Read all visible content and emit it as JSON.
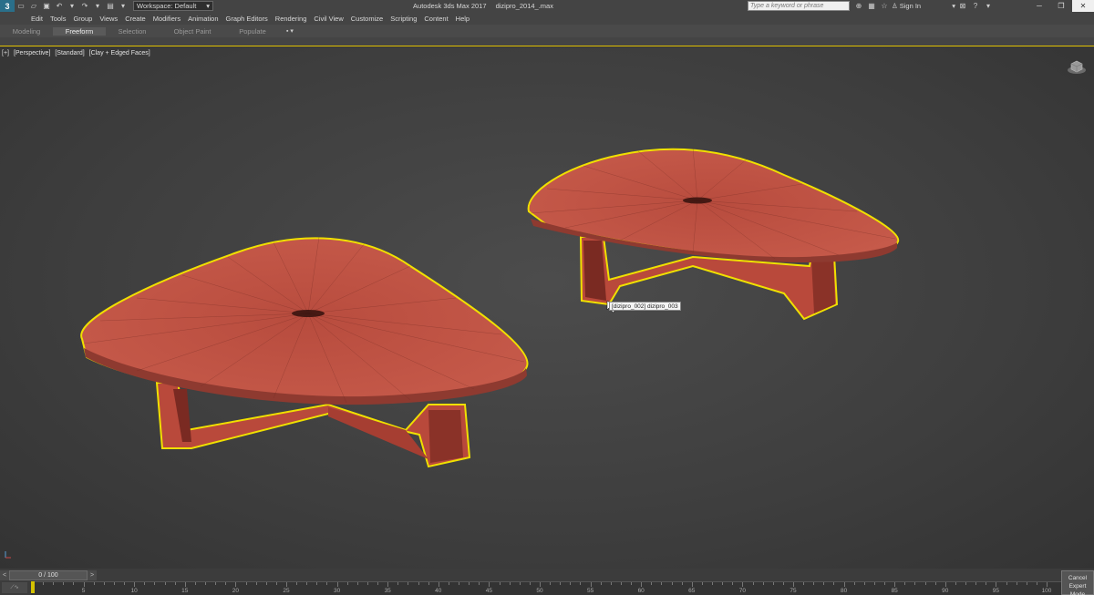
{
  "window": {
    "app_name": "Autodesk 3ds Max 2017",
    "file_name": "dizipro_2014_.max",
    "workspace_label": "Workspace: Default",
    "search_placeholder": "Type a keyword or phrase",
    "signin_label": "Sign In"
  },
  "menu": {
    "items": [
      "Edit",
      "Tools",
      "Group",
      "Views",
      "Create",
      "Modifiers",
      "Animation",
      "Graph Editors",
      "Rendering",
      "Civil View",
      "Customize",
      "Scripting",
      "Content",
      "Help"
    ]
  },
  "ribbon": {
    "tabs": [
      "Modeling",
      "Freeform",
      "Selection",
      "Object Paint",
      "Populate"
    ],
    "active_tab": "Freeform"
  },
  "viewport": {
    "labels": [
      "[+]",
      "[Perspective]",
      "[Standard]",
      "[Clay + Edged Faces]"
    ],
    "tooltip": "[dizipro_002] dizipro_003",
    "object_color": "#c45a4a",
    "selection_color": "#f0e000"
  },
  "timeline": {
    "frame_readout": "0 / 100",
    "ticks": [
      "5",
      "10",
      "15",
      "20",
      "25",
      "30",
      "35",
      "40",
      "45",
      "50",
      "55",
      "60",
      "65",
      "70",
      "75",
      "80",
      "85",
      "90",
      "95",
      "100"
    ],
    "cancel_label": "Cancel",
    "expert_label": "Expert Mode"
  }
}
